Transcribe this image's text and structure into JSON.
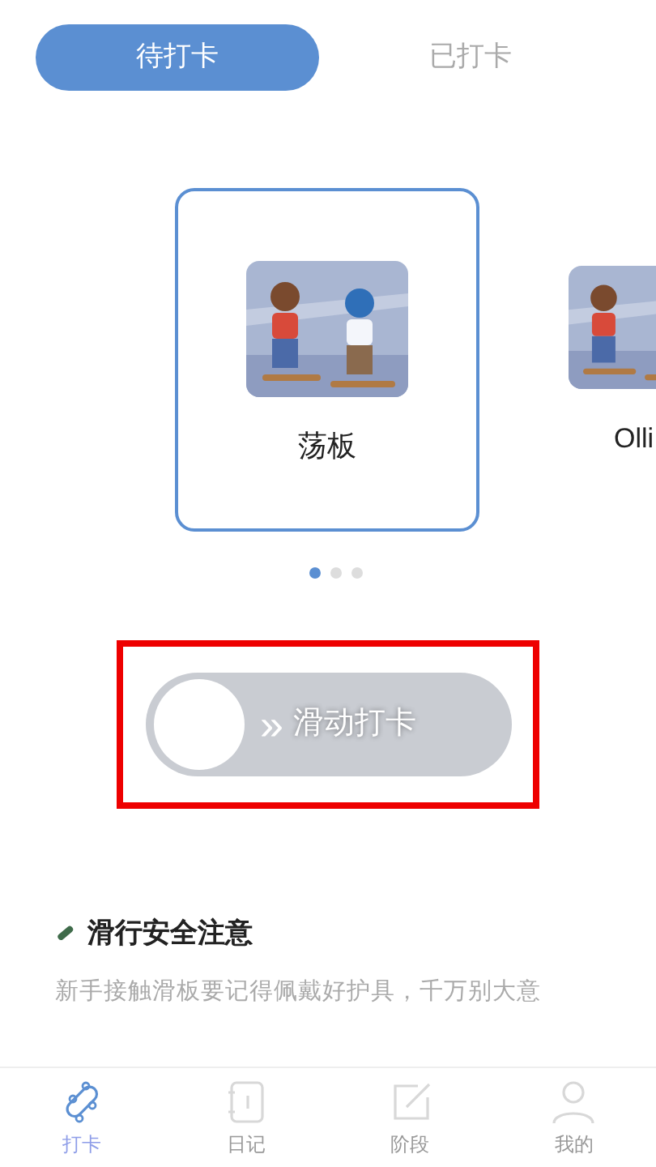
{
  "tabs": [
    {
      "label": "待打卡",
      "selected": true
    },
    {
      "label": "已打卡",
      "selected": false
    }
  ],
  "cards": [
    {
      "label": "荡板",
      "selected": true,
      "kind": "picture"
    },
    {
      "label": "Olli",
      "selected": false,
      "kind": "picture"
    }
  ],
  "pager_dots": [
    {
      "selected": true
    },
    {
      "selected": false
    },
    {
      "selected": false
    }
  ],
  "slide_button": {
    "arrows": "»",
    "label": "滑动打卡",
    "highlighted": true
  },
  "notice": {
    "title": "滑行安全注意",
    "text": "新手接触滑板要记得佩戴好护具，千万别大意"
  },
  "bottom_nav": [
    {
      "label": "打卡",
      "selected": true,
      "kind": "skateboard"
    },
    {
      "label": "日记",
      "selected": false,
      "kind": "notebook"
    },
    {
      "label": "阶段",
      "selected": false,
      "kind": "edit"
    },
    {
      "label": "我的",
      "selected": false,
      "kind": "person"
    }
  ]
}
